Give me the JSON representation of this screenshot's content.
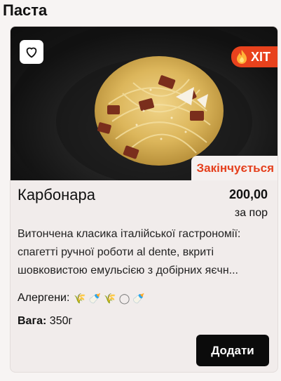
{
  "section": {
    "title": "Паста"
  },
  "product": {
    "hit_label": "ХІТ",
    "status_label": "Закінчується",
    "name": "Карбонара",
    "price": "200,00",
    "unit": "за пор",
    "description": "Витончена класика італійської гастрономії: спагетті ручної роботи al dente, вкриті шовковистою емульсією з добірних яєчн...",
    "allergens_label": "Алергени:",
    "allergen_icons": [
      "wheat-icon",
      "bottle-icon",
      "wheat-icon",
      "egg-icon",
      "bottle-icon"
    ],
    "weight_label": "Вага:",
    "weight_value": "350г",
    "add_label": "Додати"
  },
  "colors": {
    "accent": "#e8421d",
    "button": "#0b0b0b",
    "card_bg": "#f1eceb"
  }
}
